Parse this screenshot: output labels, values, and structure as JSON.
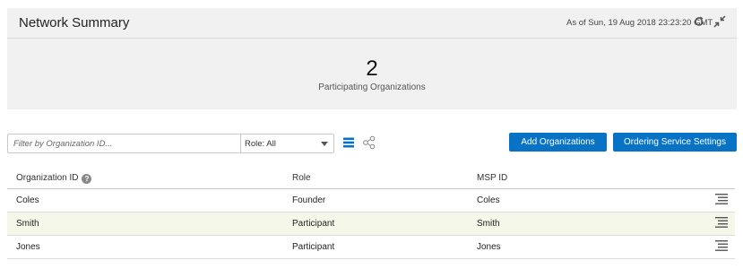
{
  "summary": {
    "title": "Network Summary",
    "as_of": "As of Sun, 19 Aug 2018 23:23:20 GMT",
    "count": "2",
    "count_label": "Participating Organizations"
  },
  "toolbar": {
    "filter_placeholder": "Filter by Organization ID...",
    "role_filter_value": "Role: All",
    "add_organizations_label": "Add Organizations",
    "ordering_service_settings_label": "Ordering Service Settings",
    "accent_color": "#0873c4"
  },
  "table": {
    "columns": [
      "Organization ID",
      "Role",
      "MSP ID"
    ],
    "rows": [
      {
        "org_id": "Coles",
        "role": "Founder",
        "msp_id": "Coles"
      },
      {
        "org_id": "Smith",
        "role": "Participant",
        "msp_id": "Smith"
      },
      {
        "org_id": "Jones",
        "role": "Participant",
        "msp_id": "Jones"
      }
    ],
    "highlight_color": "#f5f8e9"
  },
  "icons": [
    "refresh-icon",
    "collapse-icon",
    "list-view-icon",
    "graph-view-icon",
    "help-icon",
    "row-menu-icon"
  ]
}
